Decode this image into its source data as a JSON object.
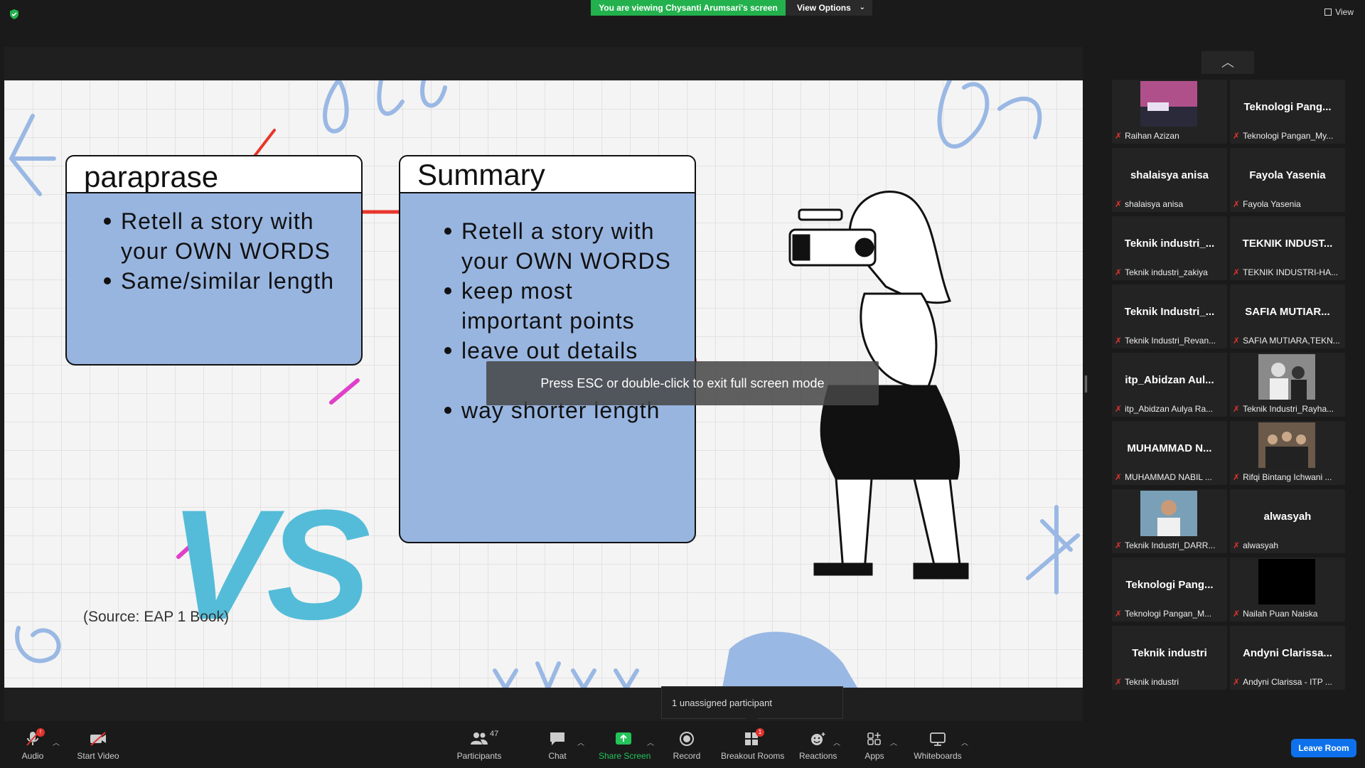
{
  "topbar": {
    "viewing_banner": "You are viewing Chysanti Arumsari's screen",
    "view_options": "View Options",
    "view_label": "View"
  },
  "slide": {
    "paraprase": {
      "title": "paraprase",
      "bullets": [
        "Retell a story with your OWN WORDS",
        "Same/similar length"
      ]
    },
    "summary": {
      "title": "Summary",
      "bullets": [
        "Retell a story with your OWN WORDS",
        "keep most important points",
        "leave out details",
        "way shorter length"
      ]
    },
    "vs": "VS",
    "source": "(Source: EAP 1 Book)"
  },
  "overlay": {
    "esc_message": "Press ESC or double-click to exit full screen mode"
  },
  "participants": [
    {
      "name": "",
      "label": "Raihan Azizan",
      "thumb": "sunset"
    },
    {
      "name": "Teknologi  Pang...",
      "label": "Teknologi Pangan_My..."
    },
    {
      "name": "shalaisya anisa",
      "label": "shalaisya anisa"
    },
    {
      "name": "Fayola Yasenia",
      "label": "Fayola Yasenia"
    },
    {
      "name": "Teknik  industri_...",
      "label": "Teknik industri_zakiya"
    },
    {
      "name": "TEKNIK  INDUST...",
      "label": "TEKNIK INDUSTRI-HA..."
    },
    {
      "name": "Teknik  Industri_...",
      "label": "Teknik Industri_Revan..."
    },
    {
      "name": "SAFIA  MUTIAR...",
      "label": "SAFIA MUTIARA,TEKN..."
    },
    {
      "name": "itp_Abidzan  Aul...",
      "label": "itp_Abidzan Aulya Ra..."
    },
    {
      "name": "",
      "label": "Teknik Industri_Rayha...",
      "thumb": "photo-bw"
    },
    {
      "name": "MUHAMMAD  N...",
      "label": "MUHAMMAD NABIL ..."
    },
    {
      "name": "",
      "label": "Rifqi Bintang Ichwani ...",
      "thumb": "photo-group"
    },
    {
      "name": "",
      "label": "Teknik Industri_DARR...",
      "thumb": "photo-person"
    },
    {
      "name": "alwasyah",
      "label": "alwasyah"
    },
    {
      "name": "Teknologi  Pang...",
      "label": "Teknologi Pangan_M..."
    },
    {
      "name": "",
      "label": "Nailah Puan Naiska",
      "thumb": "black"
    },
    {
      "name": "Teknik industri",
      "label": "Teknik industri"
    },
    {
      "name": "Andyni  Clarissa...",
      "label": "Andyni Clarissa - ITP ..."
    }
  ],
  "popup": {
    "unassigned": "1 unassigned participant"
  },
  "toolbar": {
    "audio": "Audio",
    "start_video": "Start Video",
    "participants": "Participants",
    "participants_count": "47",
    "chat": "Chat",
    "share_screen": "Share Screen",
    "record": "Record",
    "breakout_rooms": "Breakout Rooms",
    "breakout_badge": "1",
    "reactions": "Reactions",
    "apps": "Apps",
    "whiteboards": "Whiteboards",
    "leave_room": "Leave Room",
    "audio_badge": "!"
  },
  "colors": {
    "banner_green": "#23b14d",
    "leave_blue": "#0e71eb",
    "mute_red": "#e0332e",
    "slide_card_blue": "#98b5e0",
    "vs_cyan": "#54bcd8",
    "annotation_red": "#e8352b",
    "annotation_pink": "#e040c8"
  }
}
